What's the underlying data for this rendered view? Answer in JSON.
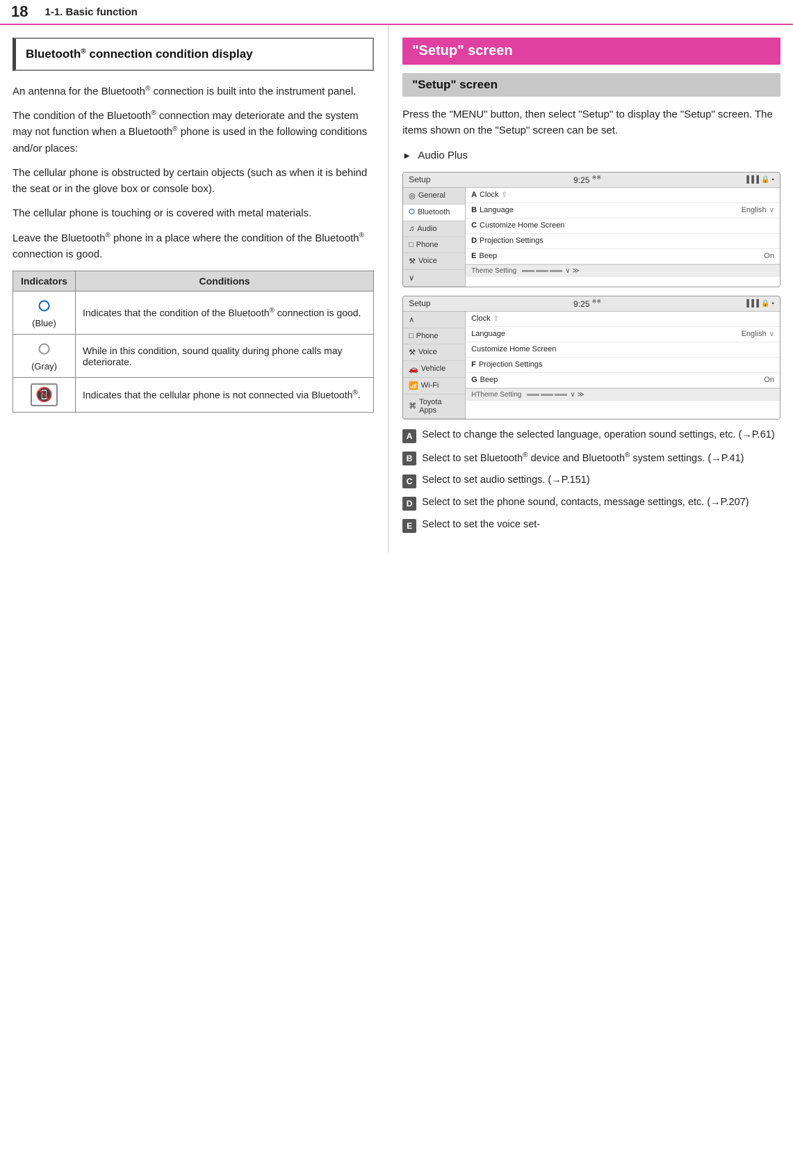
{
  "header": {
    "page_number": "18",
    "section": "1-1. Basic function"
  },
  "left": {
    "section_heading": "Bluetooth® connection condition display",
    "paragraphs": [
      "An antenna for the Bluetooth® connection is built into the instrument panel.",
      "The condition of the Bluetooth® connection may deteriorate and the system may not function when a Bluetooth® phone is used in the following conditions and/or places:",
      "The cellular phone is obstructed by certain objects (such as when it is behind the seat or in the glove box or console box).",
      "The cellular phone is touching or is covered with metal materials.",
      "Leave the Bluetooth® phone in a place where the condition of the Bluetooth® connection is good."
    ],
    "table": {
      "col1": "Indicators",
      "col2": "Conditions",
      "rows": [
        {
          "icon_type": "bt_blue",
          "icon_label": "(Blue)",
          "condition": "Indicates that the condition of the Bluetooth® connection is good."
        },
        {
          "icon_type": "bt_gray",
          "icon_label": "(Gray)",
          "condition": "While in this condition, sound quality during phone calls may deteriorate."
        },
        {
          "icon_type": "phone_slash",
          "icon_label": "",
          "condition": "Indicates that the cellular phone is not connected via Bluetooth®."
        }
      ]
    }
  },
  "right": {
    "title": "\"Setup\" screen",
    "subtitle": "\"Setup\" screen",
    "intro_text": "Press the \"MENU\" button, then select \"Setup\" to display the \"Setup\" screen. The items shown on the \"Setup\" screen can be set.",
    "bullet": "Audio Plus",
    "screen1": {
      "app_label": "Setup",
      "time": "9:25",
      "sidebar_items": [
        "General",
        "Bluetooth",
        "Audio",
        "Phone",
        "Voice",
        ""
      ],
      "rows": [
        {
          "letter": "A",
          "label": "Clock",
          "value": "",
          "chevron": "↑"
        },
        {
          "letter": "B",
          "label": "Language",
          "value": "English",
          "chevron": "∨"
        },
        {
          "letter": "C",
          "label": "Customize Home Screen",
          "value": "",
          "chevron": ""
        },
        {
          "letter": "D",
          "label": "Projection Settings",
          "value": "",
          "chevron": ""
        },
        {
          "letter": "E",
          "label": "Beep",
          "value": "On",
          "chevron": ""
        },
        {
          "letter": "",
          "label": "Theme Setting",
          "value": "",
          "chevron": "∨∨"
        }
      ]
    },
    "screen2": {
      "app_label": "Setup",
      "time": "9:25",
      "sidebar_items": [
        "",
        "Phone",
        "Voice",
        "Vehicle",
        "Wi-Fi",
        "Toyota Apps"
      ],
      "rows": [
        {
          "letter": "",
          "label": "Clock",
          "value": "",
          "chevron": "↑"
        },
        {
          "letter": "",
          "label": "Language",
          "value": "English",
          "chevron": "∨"
        },
        {
          "letter": "",
          "label": "Customize Home Screen",
          "value": "",
          "chevron": ""
        },
        {
          "letter": "F",
          "label": "Projection Settings",
          "value": "",
          "chevron": ""
        },
        {
          "letter": "G",
          "label": "Beep",
          "value": "On",
          "chevron": ""
        },
        {
          "letter": "H",
          "label": "Theme Setting",
          "value": "",
          "chevron": "∨∨"
        }
      ]
    },
    "lettered_items": [
      {
        "letter": "A",
        "text": "Select to change the selected language, operation sound settings, etc. (→P.61)"
      },
      {
        "letter": "B",
        "text": "Select to set Bluetooth® device and Bluetooth® system settings. (→P.41)"
      },
      {
        "letter": "C",
        "text": "Select to set audio settings. (→P.151)"
      },
      {
        "letter": "D",
        "text": "Select to set the phone sound, contacts, message settings, etc. (→P.207)"
      },
      {
        "letter": "E",
        "text": "Select to set the voice set-"
      }
    ]
  }
}
